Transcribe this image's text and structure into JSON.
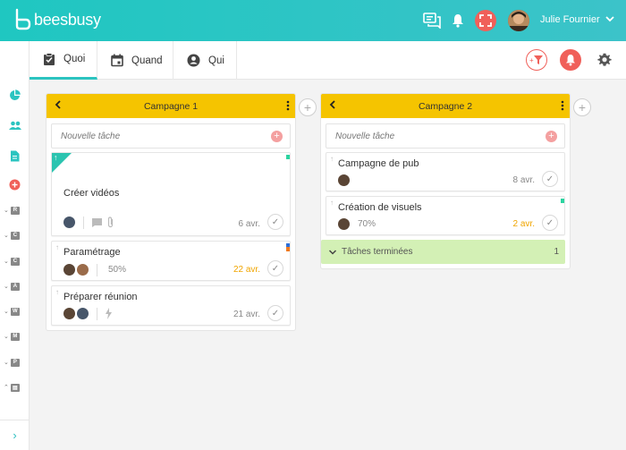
{
  "header": {
    "logo_text": "beesbusy",
    "user_name": "Julie Fournier",
    "brand_color": "#2bc4c0",
    "alert_color": "#f0605a"
  },
  "tabs": [
    {
      "label": "Quoi",
      "icon": "checklist-icon",
      "active": true
    },
    {
      "label": "Quand",
      "icon": "calendar-icon",
      "active": false
    },
    {
      "label": "Qui",
      "icon": "user-circle-icon",
      "active": false
    }
  ],
  "sidebar": {
    "groups": [
      "R",
      "C",
      "C",
      "A",
      "W",
      "M",
      "P",
      ""
    ]
  },
  "columns": [
    {
      "title": "Campagne 1",
      "new_task_placeholder": "Nouvelle tâche",
      "cards": [
        {
          "title": "Créer vidéos",
          "date": "6 avr.",
          "progress": "",
          "overdue": false
        },
        {
          "title": "Paramétrage",
          "date": "22 avr.",
          "progress": "50%",
          "overdue": true
        },
        {
          "title": "Préparer réunion",
          "date": "21 avr.",
          "progress": "",
          "overdue": false
        }
      ]
    },
    {
      "title": "Campagne 2",
      "new_task_placeholder": "Nouvelle tâche",
      "cards": [
        {
          "title": "Campagne de pub",
          "date": "8 avr.",
          "progress": "",
          "overdue": false
        },
        {
          "title": "Création de visuels",
          "date": "2 avr.",
          "progress": "70%",
          "overdue": true
        }
      ],
      "done_label": "Tâches terminées",
      "done_count": "1"
    }
  ]
}
